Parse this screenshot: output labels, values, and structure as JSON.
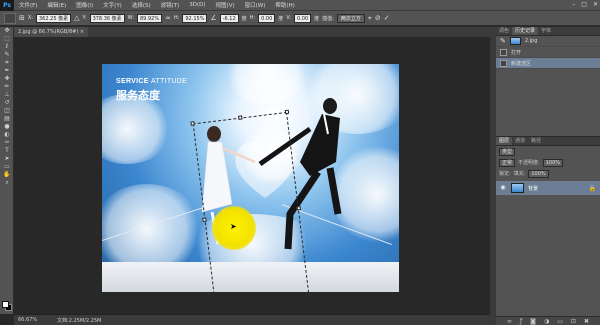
{
  "app": {
    "logo": "Ps"
  },
  "menu": [
    "文件(F)",
    "编辑(E)",
    "图像(I)",
    "文字(Y)",
    "选择(S)",
    "滤镜(T)",
    "3D(D)",
    "视图(V)",
    "窗口(W)",
    "帮助(H)"
  ],
  "window_controls": [
    "–",
    "□",
    "✕"
  ],
  "options": {
    "x_label": "X:",
    "x_value": "362.25 像素",
    "y_label": "Y:",
    "y_value": "378.36 像素",
    "w_label": "W:",
    "w_value": "89.92%",
    "h_label": "H:",
    "h_value": "92.15%",
    "angle_value": "-6.12",
    "angle_unit": "度",
    "hskew_label": "H:",
    "hskew_value": "0.00",
    "hskew_unit": "度",
    "vskew_label": "V:",
    "vskew_value": "0.00",
    "vskew_unit": "度",
    "interp_label": "插值:",
    "interp_value": "两次立方"
  },
  "document_tab": "2.jpg @ 66.7%(RGB/8#) ×",
  "canvas": {
    "title_en_bold": "SERVICE",
    "title_en_thin": "ATTITUDE",
    "title_cn": "服务态度"
  },
  "status": {
    "zoom": "66.67%",
    "doc_size": "文档:2.25M/2.25M"
  },
  "history_panel": {
    "tabs": [
      "调色",
      "历史记录",
      "字体"
    ],
    "snapshot": "2.jpg",
    "items": [
      "打开",
      "新建选区"
    ],
    "selected_index": 1
  },
  "layers_panel": {
    "tabs": [
      "图层",
      "通道",
      "路径"
    ],
    "kind_filter": "类型",
    "blend_mode": "正常",
    "opacity_label": "不透明度:",
    "opacity_value": "100%",
    "lock_label": "锁定:",
    "fill_label": "填充:",
    "fill_value": "100%",
    "layer_name": "背景"
  },
  "colors": {
    "foreground": "#ffffff",
    "background": "#000000",
    "selection": "#6b7e96",
    "cursor_dot": "#fff200"
  }
}
